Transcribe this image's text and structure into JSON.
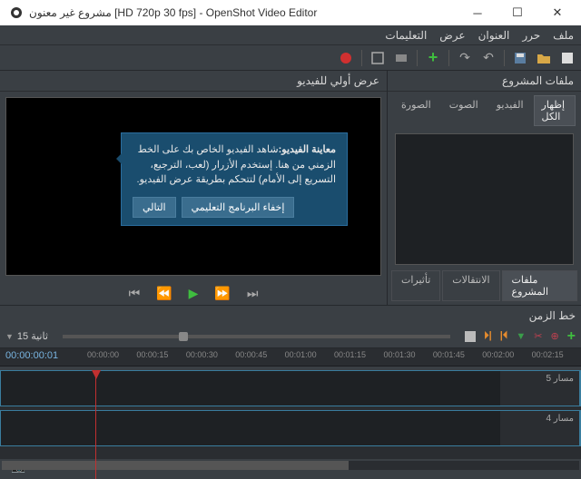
{
  "window": {
    "title": "مشروع غير معنون [HD 720p 30 fps] - OpenShot Video Editor"
  },
  "menu": {
    "file": "ملف",
    "edit": "حرر",
    "title_menu": "العنوان",
    "view": "عرض",
    "help": "التعليمات"
  },
  "panels": {
    "project_files": "ملفات المشروع",
    "video_preview": "عرض أولي للفيديو",
    "timeline": "خط الزمن"
  },
  "filters": {
    "show_all": "إظهار الكل",
    "video": "الفيديو",
    "audio": "الصوت",
    "image": "الصورة"
  },
  "bottom_tabs": {
    "project_files": "ملفات المشروع",
    "transitions": "الانتقالات",
    "effects": "تأثيرات"
  },
  "tutorial": {
    "heading": "معاينة الفيديو:",
    "body": "شاهد الفيديو الخاص بك على الخط الزمني من هنا. إستخدم الأزرار (لعب، الترجيع، التسريع إلى الأمام) لتتحكم بطريقة عرض الفيديو.",
    "next": "التالي",
    "hide": "إخفاء البرنامج التعليمي"
  },
  "timeline": {
    "zoom_label": "15 ثانية",
    "timecode": "00:00:00:01",
    "ruler": [
      "00:00:00",
      "00:00:15",
      "00:00:30",
      "00:00:45",
      "00:01:00",
      "00:01:15",
      "00:01:30",
      "00:01:45",
      "00:02:00",
      "00:02:15"
    ],
    "tracks": [
      "مسار 5",
      "مسار 4"
    ]
  }
}
